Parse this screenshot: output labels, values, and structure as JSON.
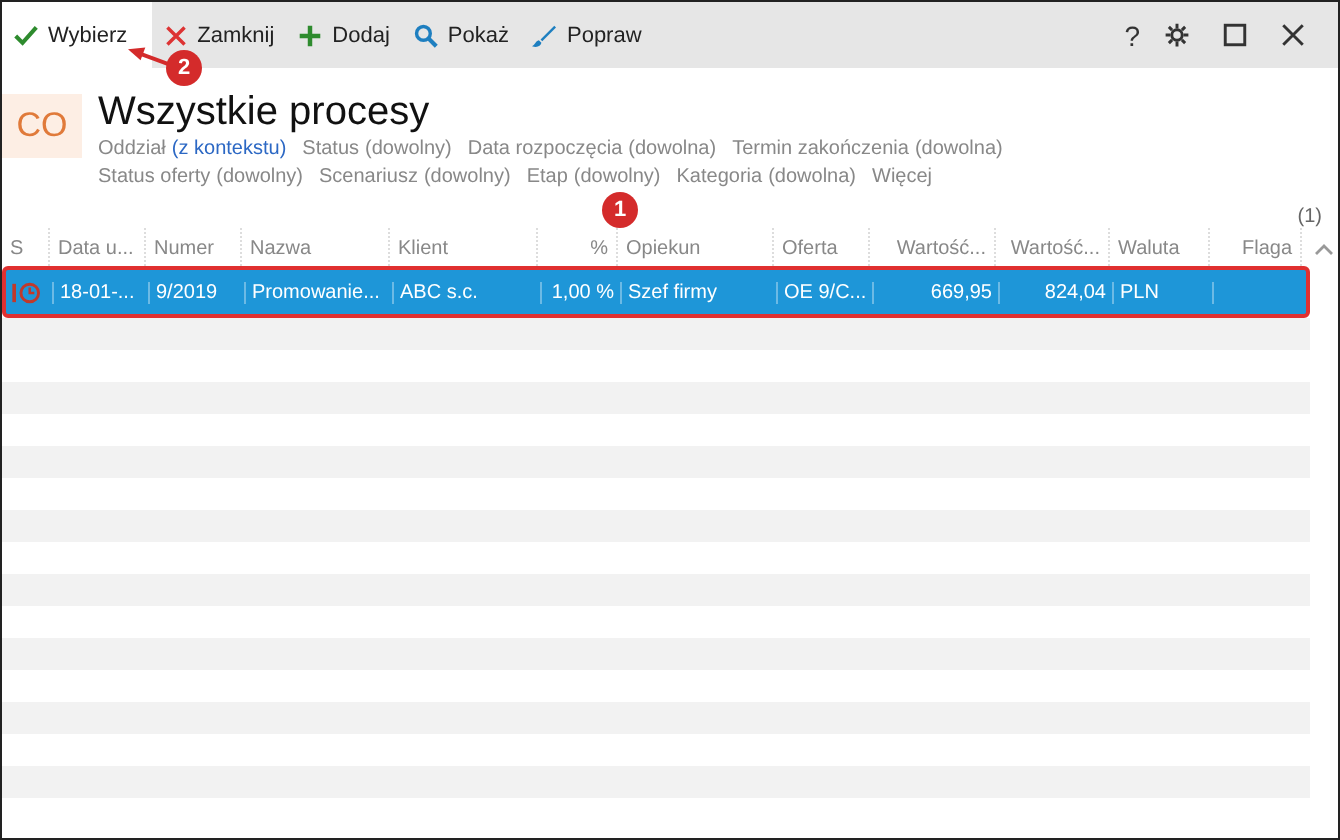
{
  "toolbar": {
    "buttons": [
      {
        "label": "Wybierz",
        "kind": "check",
        "selected": true
      },
      {
        "label": "Zamknij",
        "kind": "close",
        "selected": false
      },
      {
        "label": "Dodaj",
        "kind": "add",
        "selected": false
      },
      {
        "label": "Pokaż",
        "kind": "search",
        "selected": false
      },
      {
        "label": "Popraw",
        "kind": "edit",
        "selected": false
      }
    ],
    "window_controls": [
      {
        "kind": "help",
        "label": "?"
      },
      {
        "kind": "settings"
      },
      {
        "kind": "maximize"
      },
      {
        "kind": "close"
      }
    ]
  },
  "header": {
    "badge": "CO",
    "title": "Wszystkie procesy",
    "filter_lines": [
      [
        {
          "label": "Oddział",
          "value": "(z kontekstu)",
          "set": true
        },
        {
          "label": "Status",
          "value": "(dowolny)",
          "set": false
        },
        {
          "label": "Data rozpoczęcia",
          "value": "(dowolna)",
          "set": false
        },
        {
          "label": "Termin zakończenia",
          "value": "(dowolna)",
          "set": false
        }
      ],
      [
        {
          "label": "Status oferty",
          "value": "(dowolny)",
          "set": false
        },
        {
          "label": "Scenariusz",
          "value": "(dowolny)",
          "set": false
        },
        {
          "label": "Etap",
          "value": "(dowolny)",
          "set": false
        },
        {
          "label": "Kategoria",
          "value": "(dowolna)",
          "set": false
        },
        {
          "label": "Więcej"
        }
      ]
    ],
    "count": "(1)"
  },
  "table": {
    "columns": [
      "S",
      "Data u...",
      "Numer",
      "Nazwa",
      "Klient",
      "%",
      "Opiekun",
      "Oferta",
      "Wartość...",
      "Wartość...",
      "Waluta",
      "Flaga"
    ],
    "rows": [
      {
        "selected": true,
        "cells": [
          "",
          "18-01-...",
          "9/2019",
          "Promowanie...",
          "ABC s.c.",
          "1,00 %",
          "Szef firmy",
          "OE 9/C...",
          "669,95",
          "824,04",
          "PLN",
          ""
        ]
      }
    ]
  },
  "annotations": [
    {
      "label": "1",
      "kind": "marker"
    },
    {
      "label": "2",
      "kind": "arrow_marker"
    }
  ]
}
